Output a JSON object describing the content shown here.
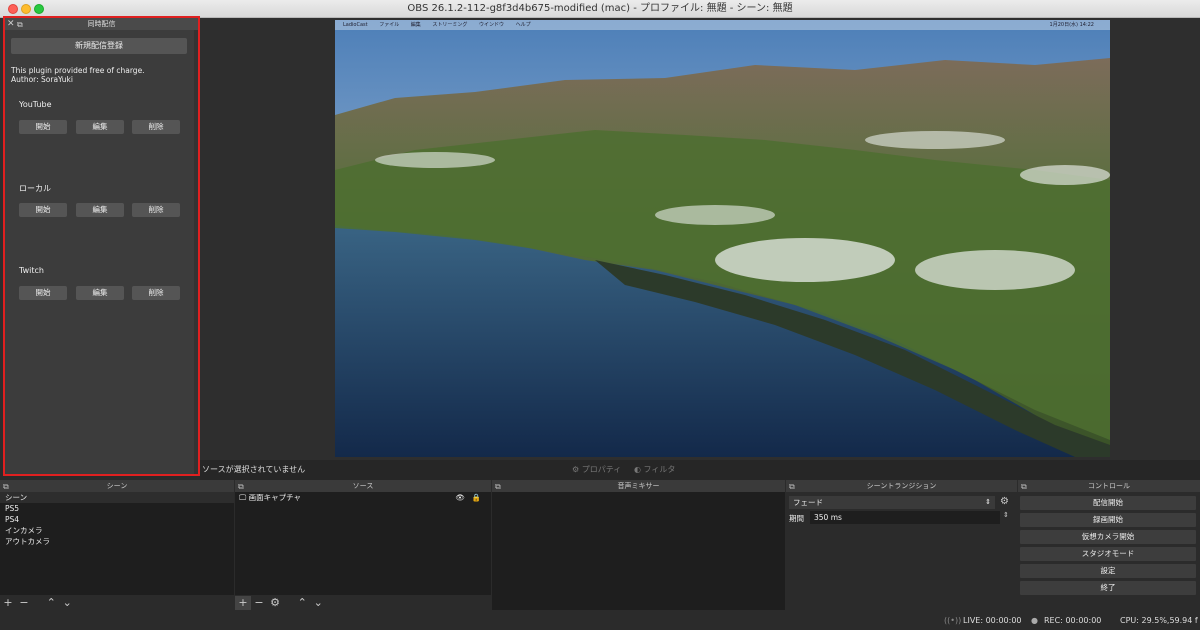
{
  "window": {
    "title": "OBS 26.1.2-112-g8f3d4b675-modified (mac) - プロファイル: 無題 - シーン: 無題"
  },
  "preview": {
    "menubar": [
      "LadioCast",
      "ファイル",
      "編集",
      "ストリーミング",
      "ウインドウ",
      "ヘルプ"
    ],
    "clock": "1月20日(水) 14:22"
  },
  "simulcast": {
    "title": "同時配信",
    "register_button": "新規配信登録",
    "info_line1": "This plugin provided free of charge.",
    "info_line2": "Author: SoraYuki",
    "services": [
      {
        "name": "YouTube",
        "start": "開始",
        "edit": "編集",
        "delete": "削除"
      },
      {
        "name": "ローカル",
        "start": "開始",
        "edit": "編集",
        "delete": "削除"
      },
      {
        "name": "Twitch",
        "start": "開始",
        "edit": "編集",
        "delete": "削除"
      }
    ]
  },
  "sourcebar": {
    "label": "ソースが選択されていません",
    "properties": "プロパティ",
    "filters": "フィルタ"
  },
  "scenes": {
    "title": "シーン",
    "items": [
      "シーン",
      "PS5",
      "PS4",
      "インカメラ",
      "アウトカメラ"
    ]
  },
  "sources": {
    "title": "ソース",
    "items": [
      "画面キャプチャ"
    ]
  },
  "mixer": {
    "title": "音声ミキサー"
  },
  "transitions": {
    "title": "シーントランジション",
    "type": "フェード",
    "duration_label": "期間",
    "duration": "350 ms"
  },
  "controls": {
    "title": "コントロール",
    "buttons": [
      "配信開始",
      "録画開始",
      "仮想カメラ開始",
      "スタジオモード",
      "設定",
      "終了"
    ]
  },
  "status": {
    "live": "LIVE: 00:00:00",
    "rec": "REC: 00:00:00",
    "cpu": "CPU: 29.5%,59.94 f"
  }
}
